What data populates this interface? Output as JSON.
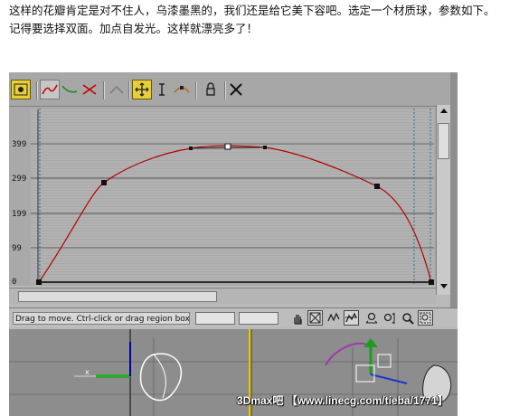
{
  "article": {
    "line1": "这样的花瓣肯定是对不住人，乌漆墨黑的，我们还是给它美下容吧。选定一个材质球，参数如下。",
    "line2": "记得要选择双面。加点自发光。这样就漂亮多了！"
  },
  "curve_editor": {
    "y_axis_labels": [
      "399",
      "299",
      "199",
      "99",
      "0"
    ],
    "status_prompt": "Drag to move. Ctrl-click or drag region box to a",
    "coordinate_fields": [
      "",
      ""
    ]
  },
  "toolbar_icons": [
    "make-default-icon",
    "color-curve-red-icon",
    "color-curve-green-icon",
    "color-curve-cross-icon",
    "insert-point-icon",
    "move-point-icon",
    "scale-point-icon",
    "insert-bezier-icon",
    "lock-icon",
    "delete-point-icon"
  ],
  "status_icons": [
    "pan-icon",
    "zoom-extents-icon",
    "zoom-horizontal-extents-icon",
    "zoom-value-extents-icon",
    "zoom-horizontal-icon",
    "zoom-vertical-icon",
    "zoom-icon",
    "zoom-region-icon"
  ],
  "watermark": "3Dmax吧 【www.linecg.com/tieba/1771】",
  "colors": {
    "curve": "#b30000",
    "graph_bg": "#a9a9a9",
    "toolbar_bg": "#a7a7a7",
    "active_button": "#e6cf3a"
  }
}
